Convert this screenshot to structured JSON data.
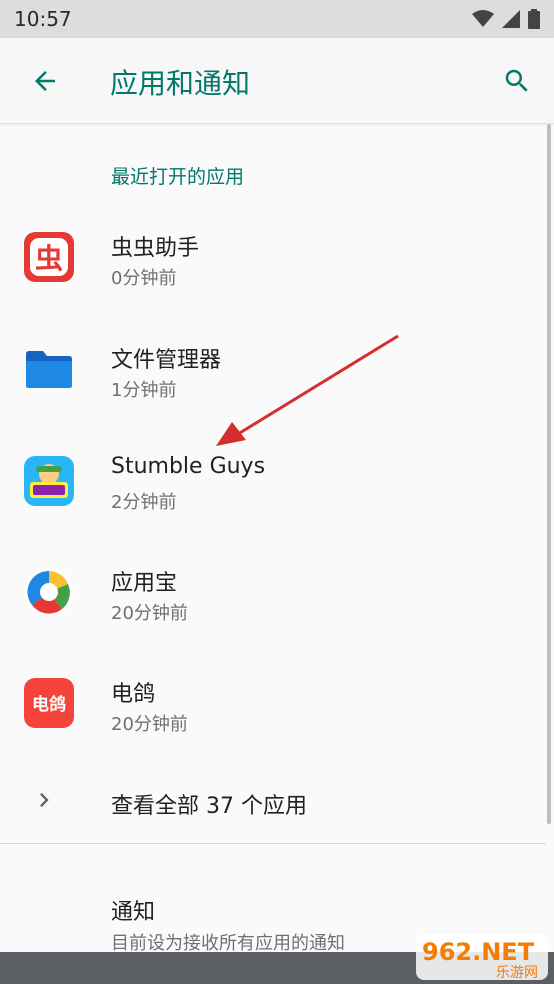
{
  "status_bar": {
    "time": "10:57"
  },
  "app_bar": {
    "title": "应用和通知"
  },
  "recent_apps": {
    "header": "最近打开的应用",
    "items": [
      {
        "name": "虫虫助手",
        "time": "0分钟前",
        "icon": "chongchong-icon",
        "icon_text": "虫"
      },
      {
        "name": "文件管理器",
        "time": "1分钟前",
        "icon": "folder-icon"
      },
      {
        "name": "Stumble Guys",
        "time": "2分钟前",
        "icon": "stumble-guys-icon"
      },
      {
        "name": "应用宝",
        "time": "20分钟前",
        "icon": "yingyongbao-icon"
      },
      {
        "name": "电鸽",
        "time": "20分钟前",
        "icon": "dian-ge-icon",
        "icon_text": "电鸽"
      }
    ]
  },
  "see_all": {
    "label": "查看全部 37 个应用"
  },
  "notifications": {
    "title": "通知",
    "subtitle": "目前设为接收所有应用的通知"
  },
  "watermark": {
    "text": "962.NET",
    "sub": "乐游网"
  },
  "colors": {
    "accent": "#00796b",
    "arrow": "#d32f2f"
  }
}
